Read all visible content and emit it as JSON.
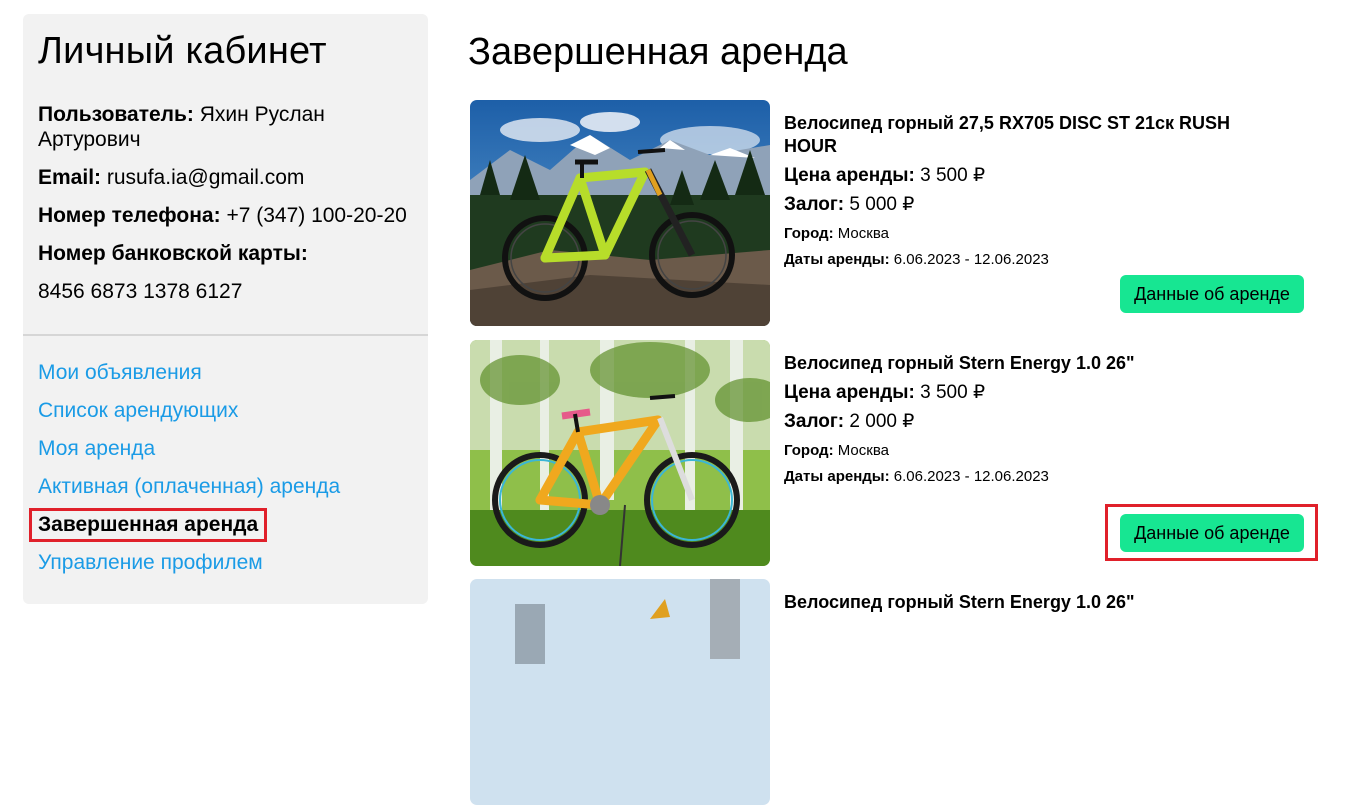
{
  "sidebar": {
    "title": "Личный кабинет",
    "user": {
      "label": "Пользователь:",
      "value": "Яхин Руслан Артурович"
    },
    "email": {
      "label": "Email:",
      "value": "rusufa.ia@gmail.com"
    },
    "phone": {
      "label": "Номер телефона:",
      "value": "+7 (347) 100-20-20"
    },
    "card": {
      "label": "Номер банковской карты:",
      "value": "8456 6873 1378 6127"
    },
    "nav": [
      {
        "label": "Мои объявления"
      },
      {
        "label": "Список арендующих"
      },
      {
        "label": "Моя аренда"
      },
      {
        "label": "Активная (оплаченная) аренда"
      },
      {
        "label": "Завершенная аренда",
        "active": true
      },
      {
        "label": "Управление профилем"
      }
    ]
  },
  "main": {
    "title": "Завершенная аренда",
    "labels": {
      "price": "Цена аренды:",
      "deposit": "Залог:",
      "city": "Город:",
      "dates": "Даты аренды:",
      "button": "Данные об аренде"
    },
    "rentals": [
      {
        "title": "Велосипед горный 27,5 RX705 DISC ST 21ск RUSH HOUR",
        "price": "3 500 ₽",
        "deposit": "5 000 ₽",
        "city": "Москва",
        "dates": "6.06.2023 - 12.06.2023",
        "image": "green-mountain-bike-photo"
      },
      {
        "title": "Велосипед горный Stern Energy 1.0 26\"",
        "price": "3 500 ₽",
        "deposit": "2 000 ₽",
        "city": "Москва",
        "dates": "6.06.2023 - 12.06.2023",
        "image": "orange-mountain-bike-photo"
      },
      {
        "title": "Велосипед горный Stern Energy 1.0 26\"",
        "image": "bike-photo-partial"
      }
    ]
  },
  "colors": {
    "link": "#1a9be6",
    "button": "#17e692",
    "highlight": "#e0202a",
    "sidebar_bg": "#f2f2f2"
  }
}
